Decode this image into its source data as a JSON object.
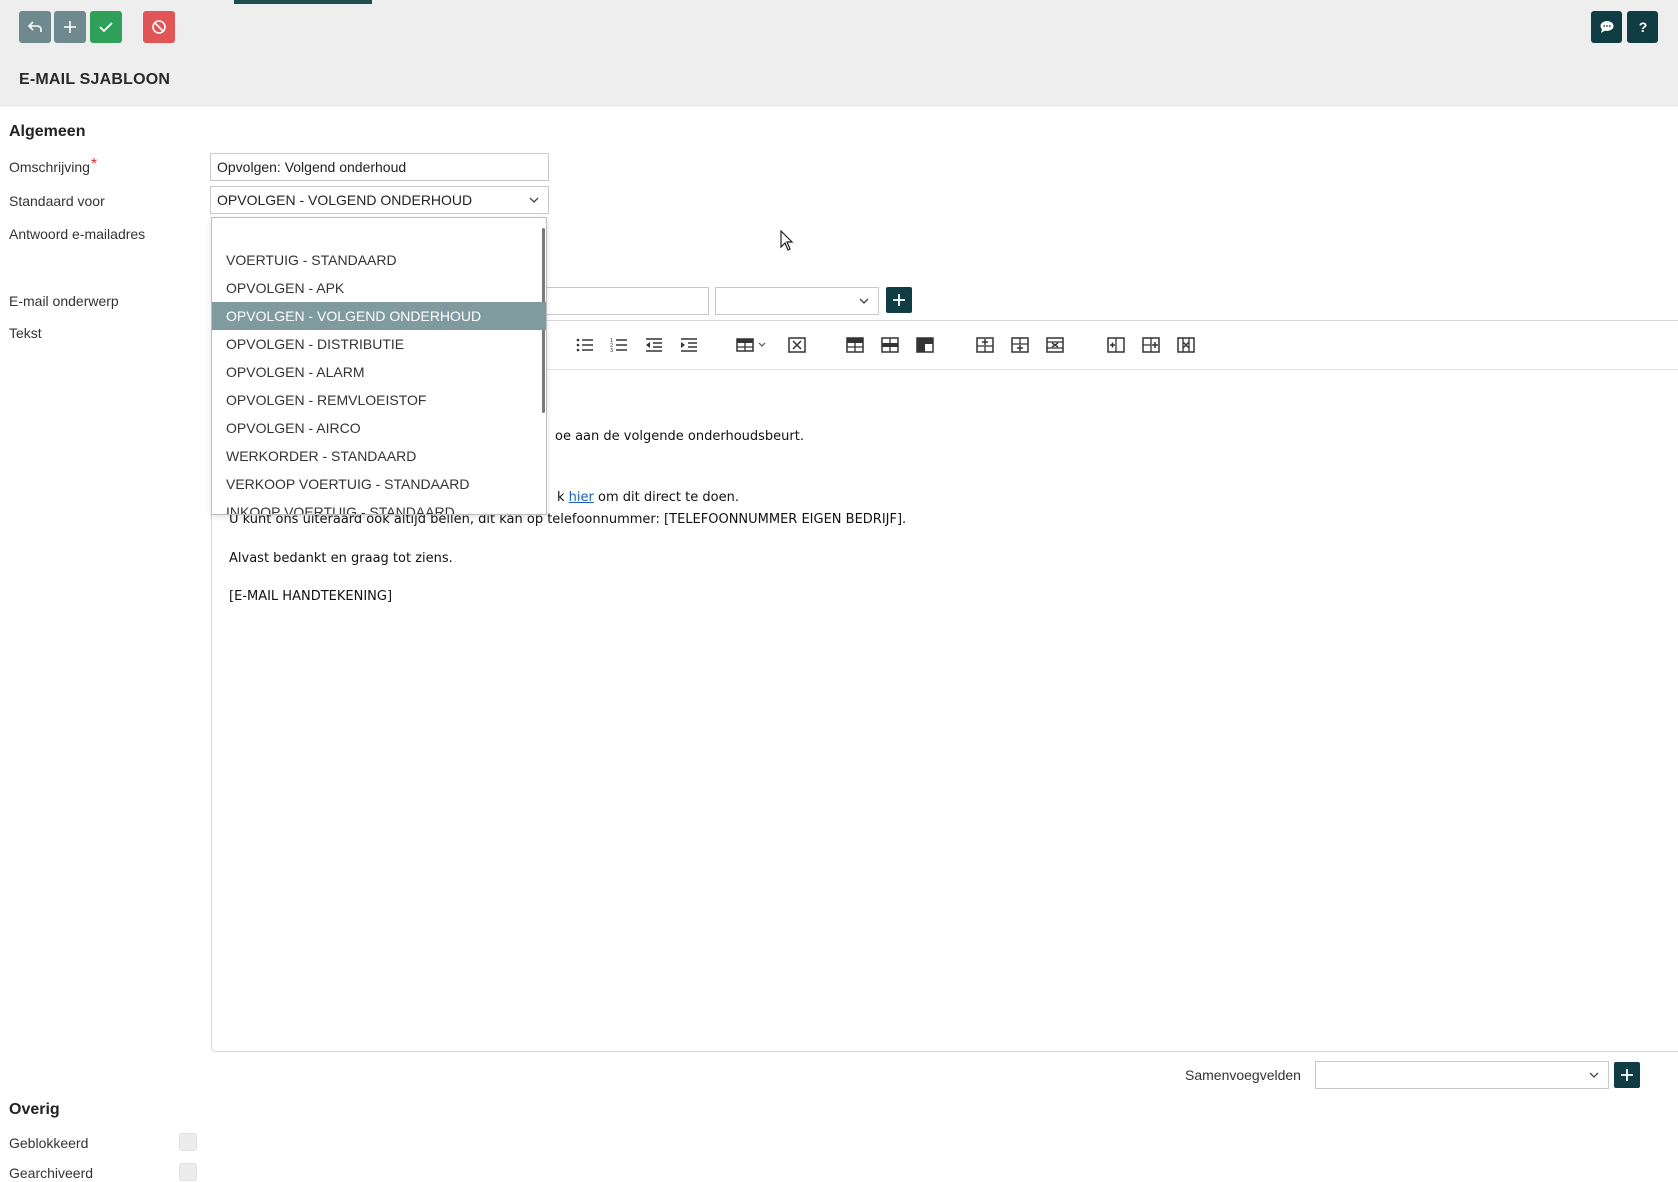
{
  "toolbar": {
    "buttons": [
      {
        "icon": "undo-icon",
        "color": "#6f8a8e"
      },
      {
        "icon": "plus-icon",
        "color": "#6f8a8e"
      },
      {
        "icon": "check-icon",
        "color": "#2fa05a"
      },
      {
        "icon": "cancel-icon",
        "color": "#e05555"
      }
    ],
    "right_buttons": [
      {
        "icon": "chat-icon",
        "color": "#0f3d43"
      },
      {
        "icon": "help-icon",
        "color": "#0f3d43"
      }
    ]
  },
  "page": {
    "title": "E-MAIL SJABLOON"
  },
  "general": {
    "section_title": "Algemeen",
    "omschrijving_label": "Omschrijving",
    "required_marker": "*",
    "omschrijving_value": "Opvolgen: Volgend onderhoud",
    "standaard_label": "Standaard voor",
    "standaard_value": "OPVOLGEN - VOLGEND ONDERHOUD",
    "antwoord_label": "Antwoord e-mailadres",
    "onderwerp_label": "E-mail onderwerp",
    "tekst_label": "Tekst"
  },
  "dropdown": {
    "search_value": "",
    "options": [
      "VOERTUIG - STANDAARD",
      "OPVOLGEN - APK",
      "OPVOLGEN - VOLGEND ONDERHOUD",
      "OPVOLGEN - DISTRIBUTIE",
      "OPVOLGEN - ALARM",
      "OPVOLGEN - REMVLOEISTOF",
      "OPVOLGEN - AIRCO",
      "WERKORDER - STANDAARD",
      "VERKOOP VOERTUIG - STANDAARD",
      "INKOOP VOERTUIG - STANDAARD"
    ],
    "selected": "OPVOLGEN - VOLGEND ONDERHOUD"
  },
  "editor": {
    "toolbar_icons": [
      "bullet-list-icon",
      "numbered-list-icon",
      "outdent-icon",
      "indent-icon",
      "table-icon",
      "delete-table-icon",
      "row-insert-above-icon",
      "row-insert-below-icon",
      "row-header-icon",
      "cell-insert-above-icon",
      "cell-insert-below-icon",
      "cell-delete-icon",
      "column-insert-left-icon",
      "column-insert-right-icon",
      "column-delete-icon"
    ],
    "line1": "oe aan de volgende onderhoudsbeurt.",
    "line2_pre": "k ",
    "line2_link": "hier",
    "line2_post": " om dit direct te doen.",
    "line3": "U kunt ons uiteraard ook altijd bellen, dit kan op telefoonnummer: [TELEFOONNUMMER EIGEN BEDRIJF].",
    "line4": "Alvast bedankt en graag tot ziens.",
    "line5": "[E-MAIL HANDTEKENING]"
  },
  "merge": {
    "label": "Samenvoegvelden",
    "value": ""
  },
  "other": {
    "section_title": "Overig",
    "geblokkeerd_label": "Geblokkeerd",
    "gearchiveerd_label": "Gearchiveerd",
    "geblokkeerd_checked": false,
    "gearchiveerd_checked": false
  }
}
